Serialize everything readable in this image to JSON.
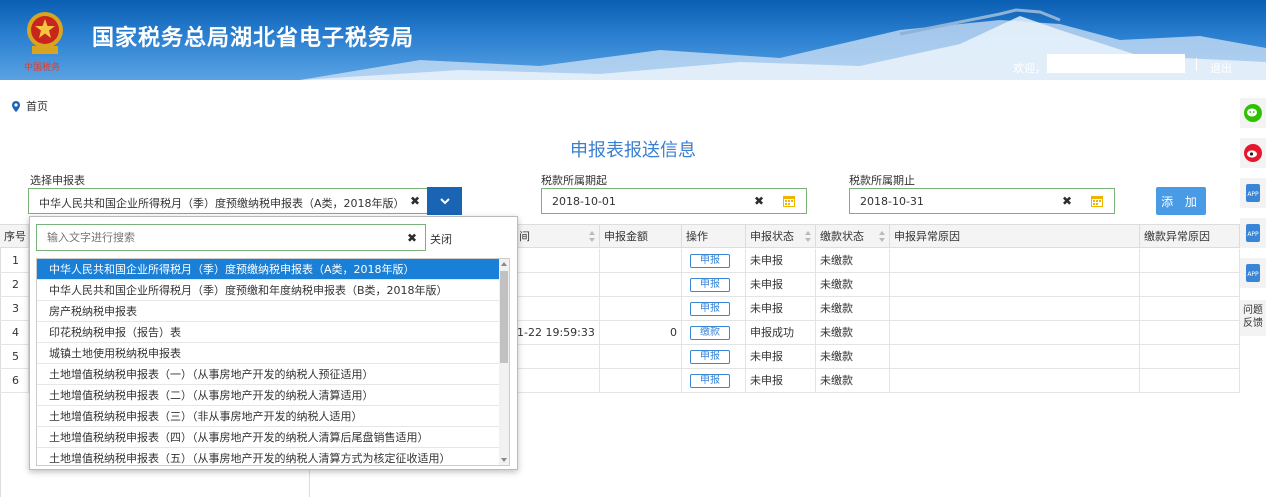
{
  "header": {
    "site_title": "国家税务总局湖北省电子税务局",
    "motto": "中国税务",
    "welcome": "欢迎，",
    "logout": "退出"
  },
  "breadcrumb": {
    "home": "首页"
  },
  "page_title": "申报表报送信息",
  "form": {
    "report_label": "选择申报表",
    "report_value": "中华人民共和国企业所得税月（季）度预缴纳税申报表（A类，2018年版）",
    "period_start_label": "税款所属期起",
    "period_start_value": "2018-10-01",
    "period_end_label": "税款所属期止",
    "period_end_value": "2018-10-31",
    "add_label": "添 加"
  },
  "dropdown": {
    "search_placeholder": "输入文字进行搜索",
    "close_label": "关闭",
    "options": [
      "中华人民共和国企业所得税月（季）度预缴纳税申报表（A类，2018年版）",
      "中华人民共和国企业所得税月（季）度预缴和年度纳税申报表（B类，2018年版）",
      "房产税纳税申报表",
      "印花税纳税申报（报告）表",
      "城镇土地使用税纳税申报表",
      "土地增值税纳税申报表（一）（从事房地产开发的纳税人预征适用）",
      "土地增值税纳税申报表（二）（从事房地产开发的纳税人清算适用）",
      "土地增值税纳税申报表（三）（非从事房地产开发的纳税人适用）",
      "土地增值税纳税申报表（四）（从事房地产开发的纳税人清算后尾盘销售适用）",
      "土地增值税纳税申报表（五）（从事房地产开发的纳税人清算方式为核定征收适用）"
    ],
    "selected_index": 0
  },
  "table": {
    "headers": {
      "seq": "序号",
      "time": "间",
      "amount": "申报金额",
      "action": "操作",
      "decl_status": "申报状态",
      "pay_status": "缴款状态",
      "decl_reason": "申报异常原因",
      "pay_reason": "缴款异常原因"
    },
    "rows": [
      {
        "seq": "1",
        "time": "",
        "amount": "",
        "action": "申报",
        "decl_status": "未申报",
        "pay_status": "未缴款"
      },
      {
        "seq": "2",
        "time": "",
        "amount": "",
        "action": "申报",
        "decl_status": "未申报",
        "pay_status": "未缴款"
      },
      {
        "seq": "3",
        "time": "",
        "amount": "",
        "action": "申报",
        "decl_status": "未申报",
        "pay_status": "未缴款"
      },
      {
        "seq": "4",
        "time": "1-22 19:59:33",
        "amount": "0",
        "action": "缴款",
        "decl_status": "申报成功",
        "pay_status": "未缴款"
      },
      {
        "seq": "5",
        "time": "",
        "amount": "",
        "action": "申报",
        "decl_status": "未申报",
        "pay_status": "未缴款"
      },
      {
        "seq": "6",
        "time": "",
        "amount": "",
        "action": "申报",
        "decl_status": "未申报",
        "pay_status": "未缴款"
      }
    ]
  },
  "sidebar": {
    "app_label": "APP",
    "feedback_label": "问题反馈"
  },
  "colors": {
    "brand_blue": "#1a64b4",
    "accent_blue": "#3a7fd0",
    "selected_row": "#1a7fd6",
    "wechat_green": "#2dc100",
    "weibo_red": "#e6162d"
  }
}
